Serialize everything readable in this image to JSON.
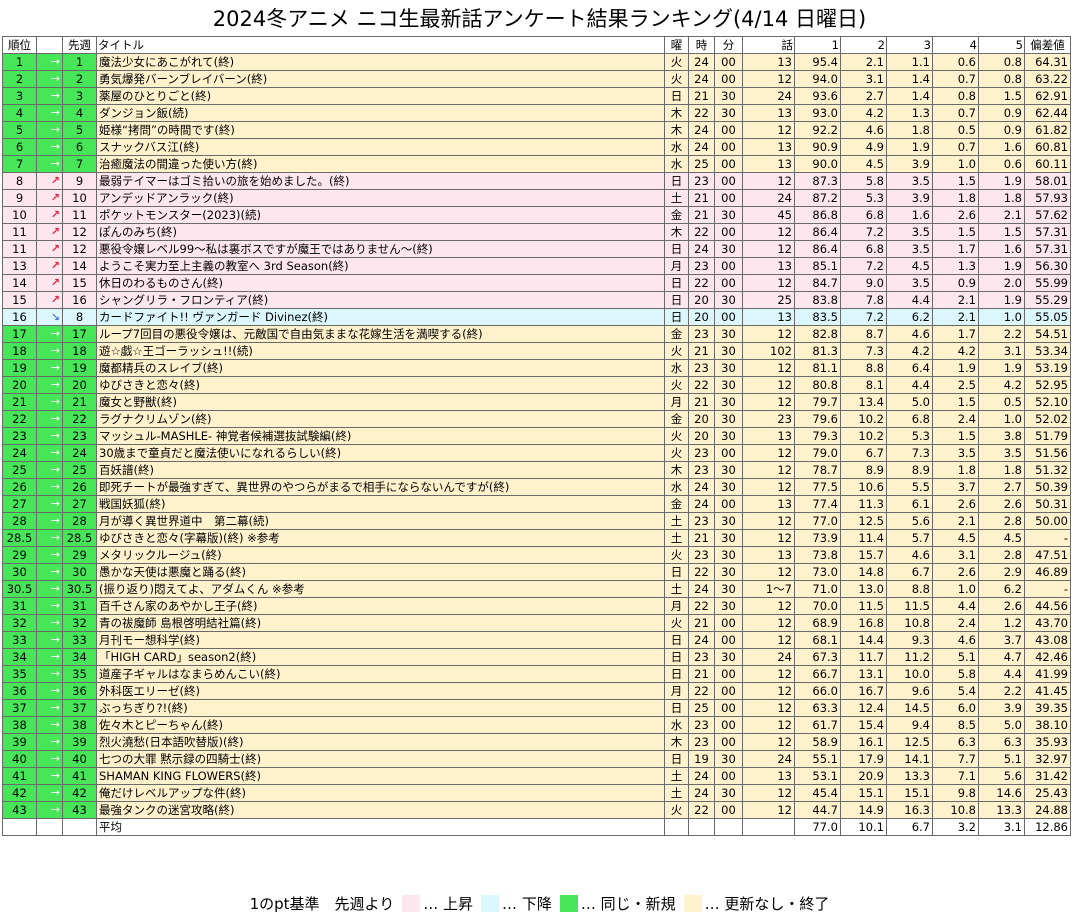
{
  "title": "2024冬アニメ ニコ生最新話アンケート結果ランキング(4/14 日曜日)",
  "headers": {
    "rank": "順位",
    "prev": "先週",
    "title": "タイトル",
    "day": "曜",
    "hour": "時",
    "minute": "分",
    "episode": "話",
    "s1": "1",
    "s2": "2",
    "s3": "3",
    "s4": "4",
    "s5": "5",
    "dev": "偏差値"
  },
  "arrows": {
    "same": "→",
    "up": "↗",
    "down": "↘"
  },
  "colors": {
    "same": "#47e659",
    "up": "#fde6ee",
    "down": "#dcf7fb",
    "none": "#fff2cc"
  },
  "rows": [
    [
      "same",
      "1",
      "1",
      "魔法少女にあこがれて(終)",
      "火",
      "24",
      "00",
      "13",
      "95.4",
      "2.1",
      "1.1",
      "0.6",
      "0.8",
      "64.31"
    ],
    [
      "same",
      "2",
      "2",
      "勇気爆発バーンブレイバーン(終)",
      "火",
      "24",
      "00",
      "12",
      "94.0",
      "3.1",
      "1.4",
      "0.7",
      "0.8",
      "63.22"
    ],
    [
      "same",
      "3",
      "3",
      "薬屋のひとりごと(終)",
      "日",
      "21",
      "30",
      "24",
      "93.6",
      "2.7",
      "1.4",
      "0.8",
      "1.5",
      "62.91"
    ],
    [
      "same",
      "4",
      "4",
      "ダンジョン飯(続)",
      "木",
      "22",
      "30",
      "13",
      "93.0",
      "4.2",
      "1.3",
      "0.7",
      "0.9",
      "62.44"
    ],
    [
      "same",
      "5",
      "5",
      "姫様“拷問”の時間です(終)",
      "木",
      "24",
      "00",
      "12",
      "92.2",
      "4.6",
      "1.8",
      "0.5",
      "0.9",
      "61.82"
    ],
    [
      "same",
      "6",
      "6",
      "スナックバス江(終)",
      "水",
      "24",
      "00",
      "13",
      "90.9",
      "4.9",
      "1.9",
      "0.7",
      "1.6",
      "60.81"
    ],
    [
      "same",
      "7",
      "7",
      "治癒魔法の間違った使い方(終)",
      "水",
      "25",
      "00",
      "13",
      "90.0",
      "4.5",
      "3.9",
      "1.0",
      "0.6",
      "60.11"
    ],
    [
      "up",
      "8",
      "9",
      "最弱テイマーはゴミ拾いの旅を始めました。(終)",
      "日",
      "23",
      "00",
      "12",
      "87.3",
      "5.8",
      "3.5",
      "1.5",
      "1.9",
      "58.01"
    ],
    [
      "up",
      "9",
      "10",
      "アンデッドアンラック(終)",
      "土",
      "21",
      "00",
      "24",
      "87.2",
      "5.3",
      "3.9",
      "1.8",
      "1.8",
      "57.93"
    ],
    [
      "up",
      "10",
      "11",
      "ポケットモンスター(2023)(続)",
      "金",
      "21",
      "30",
      "45",
      "86.8",
      "6.8",
      "1.6",
      "2.6",
      "2.1",
      "57.62"
    ],
    [
      "up",
      "11",
      "12",
      "ぽんのみち(終)",
      "木",
      "22",
      "00",
      "12",
      "86.4",
      "7.2",
      "3.5",
      "1.5",
      "1.5",
      "57.31"
    ],
    [
      "up",
      "11",
      "12",
      "悪役令嬢レベル99～私は裏ボスですが魔王ではありません～(終)",
      "日",
      "24",
      "30",
      "12",
      "86.4",
      "6.8",
      "3.5",
      "1.7",
      "1.6",
      "57.31"
    ],
    [
      "up",
      "13",
      "14",
      "ようこそ実力至上主義の教室へ 3rd Season(終)",
      "月",
      "23",
      "00",
      "13",
      "85.1",
      "7.2",
      "4.5",
      "1.3",
      "1.9",
      "56.30"
    ],
    [
      "up",
      "14",
      "15",
      "休日のわるものさん(終)",
      "日",
      "22",
      "00",
      "12",
      "84.7",
      "9.0",
      "3.5",
      "0.9",
      "2.0",
      "55.99"
    ],
    [
      "up",
      "15",
      "16",
      "シャングリラ・フロンティア(終)",
      "日",
      "20",
      "30",
      "25",
      "83.8",
      "7.8",
      "4.4",
      "2.1",
      "1.9",
      "55.29"
    ],
    [
      "down",
      "16",
      "8",
      "カードファイト!! ヴァンガード Divinez(終)",
      "日",
      "20",
      "00",
      "13",
      "83.5",
      "7.2",
      "6.2",
      "2.1",
      "1.0",
      "55.05"
    ],
    [
      "same",
      "17",
      "17",
      "ループ7回目の悪役令嬢は、元敵国で自由気ままな花嫁生活を満喫する(終)",
      "金",
      "23",
      "30",
      "12",
      "82.8",
      "8.7",
      "4.6",
      "1.7",
      "2.2",
      "54.51"
    ],
    [
      "same",
      "18",
      "18",
      "遊☆戯☆王ゴーラッシュ!!(続)",
      "火",
      "21",
      "30",
      "102",
      "81.3",
      "7.3",
      "4.2",
      "4.2",
      "3.1",
      "53.34"
    ],
    [
      "same",
      "19",
      "19",
      "魔都精兵のスレイブ(終)",
      "水",
      "23",
      "30",
      "12",
      "81.1",
      "8.8",
      "6.4",
      "1.9",
      "1.9",
      "53.19"
    ],
    [
      "same",
      "20",
      "20",
      "ゆびさきと恋々(終)",
      "火",
      "22",
      "30",
      "12",
      "80.8",
      "8.1",
      "4.4",
      "2.5",
      "4.2",
      "52.95"
    ],
    [
      "same",
      "21",
      "21",
      "魔女と野獣(終)",
      "月",
      "21",
      "30",
      "12",
      "79.7",
      "13.4",
      "5.0",
      "1.5",
      "0.5",
      "52.10"
    ],
    [
      "same",
      "22",
      "22",
      "ラグナクリムゾン(終)",
      "金",
      "20",
      "30",
      "23",
      "79.6",
      "10.2",
      "6.8",
      "2.4",
      "1.0",
      "52.02"
    ],
    [
      "same",
      "23",
      "23",
      "マッシュル-MASHLE- 神覚者候補選抜試験編(終)",
      "火",
      "20",
      "30",
      "13",
      "79.3",
      "10.2",
      "5.3",
      "1.5",
      "3.8",
      "51.79"
    ],
    [
      "same",
      "24",
      "24",
      "30歳まで童貞だと魔法使いになれるらしい(終)",
      "火",
      "23",
      "00",
      "12",
      "79.0",
      "6.7",
      "7.3",
      "3.5",
      "3.5",
      "51.56"
    ],
    [
      "same",
      "25",
      "25",
      "百妖譜(終)",
      "木",
      "23",
      "30",
      "12",
      "78.7",
      "8.9",
      "8.9",
      "1.8",
      "1.8",
      "51.32"
    ],
    [
      "same",
      "26",
      "26",
      "即死チートが最強すぎて、異世界のやつらがまるで相手にならないんですが(終)",
      "水",
      "24",
      "30",
      "12",
      "77.5",
      "10.6",
      "5.5",
      "3.7",
      "2.7",
      "50.39"
    ],
    [
      "same",
      "27",
      "27",
      "戦国妖狐(終)",
      "金",
      "24",
      "00",
      "13",
      "77.4",
      "11.3",
      "6.1",
      "2.6",
      "2.6",
      "50.31"
    ],
    [
      "same",
      "28",
      "28",
      "月が導く異世界道中　第二幕(続)",
      "土",
      "23",
      "30",
      "12",
      "77.0",
      "12.5",
      "5.6",
      "2.1",
      "2.8",
      "50.00"
    ],
    [
      "same",
      "28.5",
      "28.5",
      "ゆびさきと恋々(字幕版)(終) ※参考",
      "土",
      "21",
      "30",
      "12",
      "73.9",
      "11.4",
      "5.7",
      "4.5",
      "4.5",
      "-"
    ],
    [
      "same",
      "29",
      "29",
      "メタリックルージュ(終)",
      "火",
      "23",
      "30",
      "13",
      "73.8",
      "15.7",
      "4.6",
      "3.1",
      "2.8",
      "47.51"
    ],
    [
      "same",
      "30",
      "30",
      "愚かな天使は悪魔と踊る(終)",
      "日",
      "22",
      "30",
      "12",
      "73.0",
      "14.8",
      "6.7",
      "2.6",
      "2.9",
      "46.89"
    ],
    [
      "same",
      "30.5",
      "30.5",
      "(振り返り)悶えてよ、アダムくん ※参考",
      "土",
      "24",
      "30",
      "1～7",
      "71.0",
      "13.0",
      "8.8",
      "1.0",
      "6.2",
      "-"
    ],
    [
      "same",
      "31",
      "31",
      "百千さん家のあやかし王子(終)",
      "月",
      "22",
      "30",
      "12",
      "70.0",
      "11.5",
      "11.5",
      "4.4",
      "2.6",
      "44.56"
    ],
    [
      "same",
      "32",
      "32",
      "青の祓魔師 島根啓明結社篇(終)",
      "火",
      "21",
      "00",
      "12",
      "68.9",
      "16.8",
      "10.8",
      "2.4",
      "1.2",
      "43.70"
    ],
    [
      "same",
      "33",
      "33",
      "月刊モー想科学(終)",
      "日",
      "24",
      "00",
      "12",
      "68.1",
      "14.4",
      "9.3",
      "4.6",
      "3.7",
      "43.08"
    ],
    [
      "same",
      "34",
      "34",
      "「HIGH CARD」season2(終)",
      "日",
      "23",
      "30",
      "24",
      "67.3",
      "11.7",
      "11.2",
      "5.1",
      "4.7",
      "42.46"
    ],
    [
      "same",
      "35",
      "35",
      "道産子ギャルはなまらめんこい(終)",
      "日",
      "21",
      "00",
      "12",
      "66.7",
      "13.1",
      "10.0",
      "5.8",
      "4.4",
      "41.99"
    ],
    [
      "same",
      "36",
      "36",
      "外科医エリーゼ(終)",
      "月",
      "22",
      "00",
      "12",
      "66.0",
      "16.7",
      "9.6",
      "5.4",
      "2.2",
      "41.45"
    ],
    [
      "same",
      "37",
      "37",
      "ぶっちぎり?!(終)",
      "日",
      "25",
      "00",
      "12",
      "63.3",
      "12.4",
      "14.5",
      "6.0",
      "3.9",
      "39.35"
    ],
    [
      "same",
      "38",
      "38",
      "佐々木とピーちゃん(終)",
      "水",
      "23",
      "00",
      "12",
      "61.7",
      "15.4",
      "9.4",
      "8.5",
      "5.0",
      "38.10"
    ],
    [
      "same",
      "39",
      "39",
      "烈火澆愁(日本語吹替版)(終)",
      "木",
      "23",
      "00",
      "12",
      "58.9",
      "16.1",
      "12.5",
      "6.3",
      "6.3",
      "35.93"
    ],
    [
      "same",
      "40",
      "40",
      "七つの大罪 黙示録の四騎士(終)",
      "日",
      "19",
      "30",
      "24",
      "55.1",
      "17.9",
      "14.1",
      "7.7",
      "5.1",
      "32.97"
    ],
    [
      "same",
      "41",
      "41",
      "SHAMAN KING FLOWERS(終)",
      "土",
      "24",
      "00",
      "13",
      "53.1",
      "20.9",
      "13.3",
      "7.1",
      "5.6",
      "31.42"
    ],
    [
      "same",
      "42",
      "42",
      "俺だけレベルアップな件(終)",
      "土",
      "24",
      "30",
      "12",
      "45.4",
      "15.1",
      "15.1",
      "9.8",
      "14.6",
      "25.43"
    ],
    [
      "same",
      "43",
      "43",
      "最強タンクの迷宮攻略(終)",
      "火",
      "22",
      "00",
      "12",
      "44.7",
      "14.9",
      "16.3",
      "10.8",
      "13.3",
      "24.88"
    ]
  ],
  "average": {
    "label": "平均",
    "values": [
      "77.0",
      "10.1",
      "6.7",
      "3.2",
      "3.1",
      "12.86"
    ]
  },
  "legend": {
    "basis": "1のpt基準　先週より",
    "up": "… 上昇",
    "down": "… 下降",
    "same": "… 同じ・新規",
    "none": "… 更新なし・終了"
  }
}
